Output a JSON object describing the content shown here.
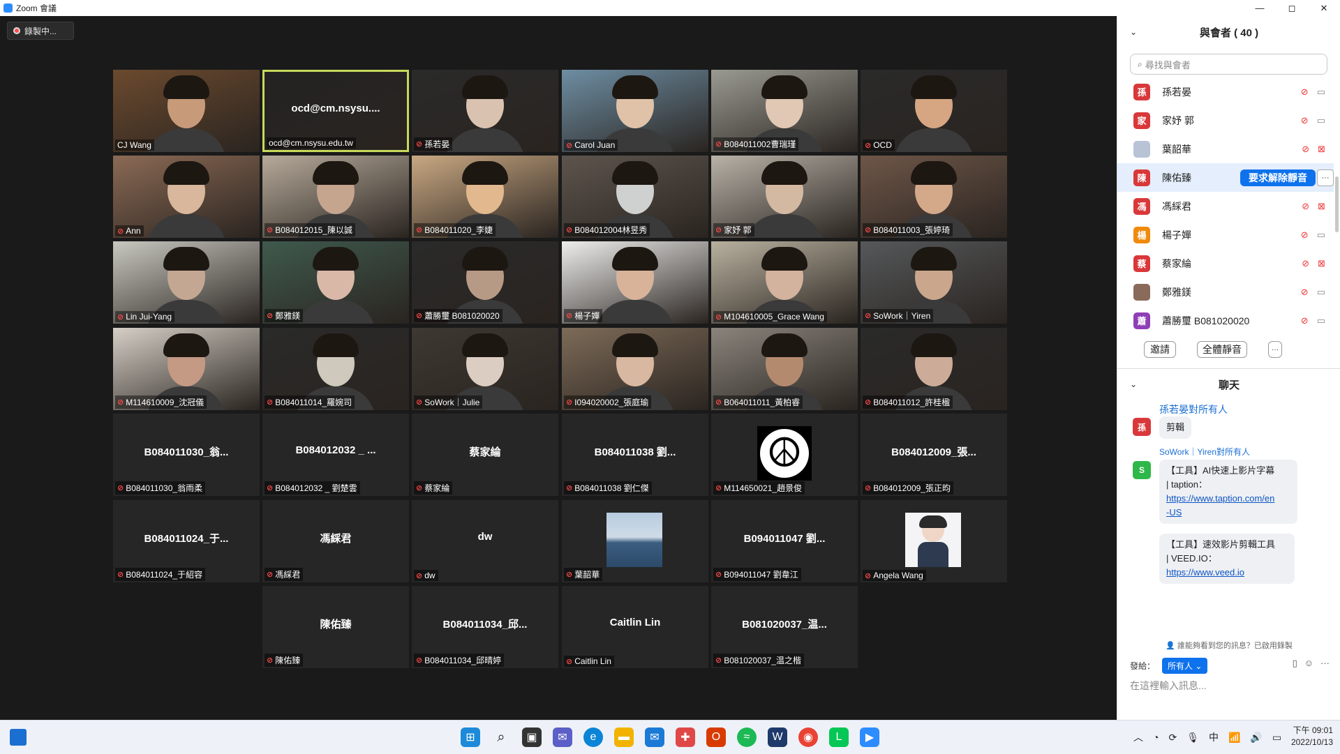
{
  "window": {
    "title": "Zoom 會議",
    "minimize": "—",
    "maximize": "◻",
    "close": "✕"
  },
  "recording_label": "錄製中...",
  "tiles": [
    {
      "label": "CJ Wang",
      "big": "",
      "muted": false,
      "bg": "#6b4a2e",
      "face": "#c79a7a",
      "active": false
    },
    {
      "label": "ocd@cm.nsysu.edu.tw",
      "big": "ocd@cm.nsysu....",
      "muted": false,
      "bg": "#232323",
      "face": "",
      "active": true
    },
    {
      "label": "孫若晏",
      "big": "",
      "muted": true,
      "bg": "#2a2a2a",
      "face": "#d9c3b0",
      "active": false
    },
    {
      "label": "Carol Juan",
      "big": "",
      "muted": true,
      "bg": "#6d8ea3",
      "face": "#e0c2a8",
      "active": false
    },
    {
      "label": "B084011002曹瑞瑾",
      "big": "",
      "muted": true,
      "bg": "#9a9a92",
      "face": "#e1c8b4",
      "active": false
    },
    {
      "label": "OCD",
      "big": "",
      "muted": true,
      "bg": "#2a2a2a",
      "face": "#d6a682",
      "active": false
    },
    {
      "label": "Ann",
      "big": "",
      "muted": true,
      "bg": "#8b6a55",
      "face": "#d8b79c",
      "active": false
    },
    {
      "label": "B084012015_陳以誠",
      "big": "",
      "muted": true,
      "bg": "#b6aa9a",
      "face": "#c6a58f",
      "active": false
    },
    {
      "label": "B084011020_李婕",
      "big": "",
      "muted": true,
      "bg": "#c9a882",
      "face": "#e2b98e",
      "active": false
    },
    {
      "label": "B084012004林昱秀",
      "big": "",
      "muted": true,
      "bg": "#5d554d",
      "face": "#cfd0d0",
      "active": false
    },
    {
      "label": "家妤 郭",
      "big": "",
      "muted": true,
      "bg": "#b8b2a8",
      "face": "#d4b9a2",
      "active": false
    },
    {
      "label": "B084011003_張婷琦",
      "big": "",
      "muted": true,
      "bg": "#6e5648",
      "face": "#d3a98a",
      "active": false
    },
    {
      "label": "Lin Jui-Yang",
      "big": "",
      "muted": true,
      "bg": "#c8c8c0",
      "face": "#c4a793",
      "active": false
    },
    {
      "label": "鄭雅鎂",
      "big": "",
      "muted": true,
      "bg": "#3f5a4d",
      "face": "#d9b8a8",
      "active": false
    },
    {
      "label": "蕭勝璽 B081020020",
      "big": "",
      "muted": true,
      "bg": "#2a2a2a",
      "face": "#b79a86",
      "active": false
    },
    {
      "label": "楊子嬋",
      "big": "",
      "muted": true,
      "bg": "#eeeeec",
      "face": "#d8b39a",
      "active": false
    },
    {
      "label": "M104610005_Grace Wang",
      "big": "",
      "muted": true,
      "bg": "#b9b19f",
      "face": "#d3b39d",
      "active": false
    },
    {
      "label": "SoWork｜Yiren",
      "big": "",
      "muted": true,
      "bg": "#55585a",
      "face": "#caa68d",
      "active": false
    },
    {
      "label": "M114610009_沈冠儀",
      "big": "",
      "muted": true,
      "bg": "#d5cfc6",
      "face": "#c49a85",
      "active": false
    },
    {
      "label": "B084011014_羅婉司",
      "big": "",
      "muted": true,
      "bg": "#2a2a2a",
      "face": "#cfc9bd",
      "active": false
    },
    {
      "label": "SoWork｜Julie",
      "big": "",
      "muted": true,
      "bg": "#3e3833",
      "face": "#dccdc2",
      "active": false
    },
    {
      "label": "I094020002_張庭瑜",
      "big": "",
      "muted": true,
      "bg": "#7d6b58",
      "face": "#d8b8a0",
      "active": false
    },
    {
      "label": "B064011011_黃柏睿",
      "big": "",
      "muted": true,
      "bg": "#8a847c",
      "face": "#b48a6e",
      "active": false
    },
    {
      "label": "B084011012_許桂楹",
      "big": "",
      "muted": true,
      "bg": "#2a2a2a",
      "face": "#ccac98",
      "active": false
    },
    {
      "label": "B084011030_翁雨柔",
      "big": "B084011030_翁...",
      "muted": true,
      "bg": "",
      "face": "",
      "active": false
    },
    {
      "label": "B084012032 _ 劉楚雲",
      "big": "B084012032 _ ...",
      "muted": true,
      "bg": "",
      "face": "",
      "active": false
    },
    {
      "label": "蔡家綸",
      "big": "蔡家綸",
      "muted": true,
      "bg": "",
      "face": "",
      "active": false
    },
    {
      "label": "B084011038 劉仁傑",
      "big": "B084011038 劉...",
      "muted": true,
      "bg": "",
      "face": "",
      "active": false
    },
    {
      "label": "M114650021_趙景俊",
      "big": "",
      "muted": true,
      "bg": "peace",
      "face": "",
      "active": false
    },
    {
      "label": "B084012009_張正昀",
      "big": "B084012009_張...",
      "muted": true,
      "bg": "",
      "face": "",
      "active": false
    },
    {
      "label": "B084011024_于紹容",
      "big": "B084011024_于...",
      "muted": true,
      "bg": "",
      "face": "",
      "active": false
    },
    {
      "label": "馮綵君",
      "big": "馮綵君",
      "muted": true,
      "bg": "",
      "face": "",
      "active": false
    },
    {
      "label": "dw",
      "big": "dw",
      "muted": true,
      "bg": "",
      "face": "",
      "active": false
    },
    {
      "label": "葉韶華",
      "big": "",
      "muted": true,
      "bg": "sea",
      "face": "",
      "active": false
    },
    {
      "label": "B094011047 劉韋江",
      "big": "B094011047 劉...",
      "muted": true,
      "bg": "",
      "face": "",
      "active": false
    },
    {
      "label": "Angela Wang",
      "big": "",
      "muted": true,
      "bg": "cartoon",
      "face": "",
      "active": false
    },
    {
      "label": "陳佑臻",
      "big": "陳佑臻",
      "muted": true,
      "bg": "",
      "face": "",
      "active": false
    },
    {
      "label": "B084011034_邱晴婷",
      "big": "B084011034_邱...",
      "muted": true,
      "bg": "",
      "face": "",
      "active": false
    },
    {
      "label": "Caitlin Lin",
      "big": "Caitlin Lin",
      "muted": true,
      "bg": "",
      "face": "",
      "active": false
    },
    {
      "label": "B081020037_温之楷",
      "big": "B081020037_温...",
      "muted": true,
      "bg": "",
      "face": "",
      "active": false
    }
  ],
  "participants_panel": {
    "title": "與會者 ( 40 )",
    "search_placeholder": "尋找與會者",
    "items": [
      {
        "avatar": "孫",
        "color": "#d9383a",
        "name": "孫若晏",
        "video_off": false
      },
      {
        "avatar": "家",
        "color": "#d9383a",
        "name": "家妤 郭",
        "video_off": false
      },
      {
        "avatar": "",
        "color": "#b9c3d6",
        "name": "葉韶華",
        "video_off": true
      },
      {
        "avatar": "陳",
        "color": "#d9383a",
        "name": "陳佑臻",
        "video_off": false
      },
      {
        "avatar": "馮",
        "color": "#d9383a",
        "name": "馮綵君",
        "video_off": true
      },
      {
        "avatar": "楊",
        "color": "#f08a0a",
        "name": "楊子嬋",
        "video_off": false
      },
      {
        "avatar": "蔡",
        "color": "#d9383a",
        "name": "蔡家綸",
        "video_off": true
      },
      {
        "avatar": "",
        "color": "#8a6a5a",
        "name": "鄭雅鎂",
        "video_off": false
      },
      {
        "avatar": "蕭",
        "color": "#8e3fb6",
        "name": "蕭勝璽 B081020020",
        "video_off": false
      }
    ],
    "selected_action": "要求解除靜音",
    "more": "···",
    "invite": "邀請",
    "mute_all": "全體靜音",
    "more_btn": "···"
  },
  "chat": {
    "title": "聊天",
    "messages": [
      {
        "sender": "孫若晏對所有人",
        "avatar": "孫",
        "color": "#d9383a",
        "lines": [
          "剪輯"
        ],
        "link": ""
      },
      {
        "sender": "SoWork｜Yiren對所有人",
        "avatar": "S",
        "color": "#2fb84a",
        "lines": [
          "【工具】AI快速上影片字幕",
          "| taption："
        ],
        "link": "https://www.taption.com/en-US"
      },
      {
        "sender": "",
        "avatar": "",
        "color": "",
        "lines": [
          "【工具】速效影片剪輯工具",
          "| VEED.IO："
        ],
        "link": "https://www.veed.io"
      }
    ],
    "link1_a": "https://www.taption.com/en",
    "link1_b": "-US",
    "notice": "誰能夠看到您的訊息？已啟用錄製",
    "send_to_label": "發給：",
    "send_to_value": "所有人 ⌄",
    "input_placeholder": "在這裡輸入訊息..."
  },
  "taskbar": {
    "time": "下午 09:01",
    "date": "2022/10/13",
    "ime": "中"
  }
}
